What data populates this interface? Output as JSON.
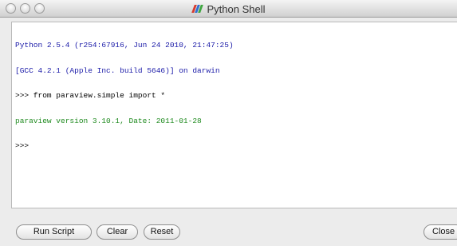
{
  "window": {
    "title": "Python Shell",
    "title_icon": "paraview-logo-icon"
  },
  "console": {
    "lines": [
      {
        "text": "Python 2.5.4 (r254:67916, Jun 24 2010, 21:47:25)",
        "color": "#1a1aa8"
      },
      {
        "text": "[GCC 4.2.1 (Apple Inc. build 5646)] on darwin",
        "color": "#1a1aa8"
      },
      {
        "text": ">>> from paraview.simple import *",
        "color": "#000000"
      },
      {
        "text": "paraview version 3.10.1, Date: 2011-01-28",
        "color": "#1f8a1f"
      },
      {
        "text": ">>>",
        "color": "#000000"
      }
    ]
  },
  "buttons": {
    "run_script": "Run Script",
    "clear": "Clear",
    "reset": "Reset",
    "close": "Close"
  }
}
